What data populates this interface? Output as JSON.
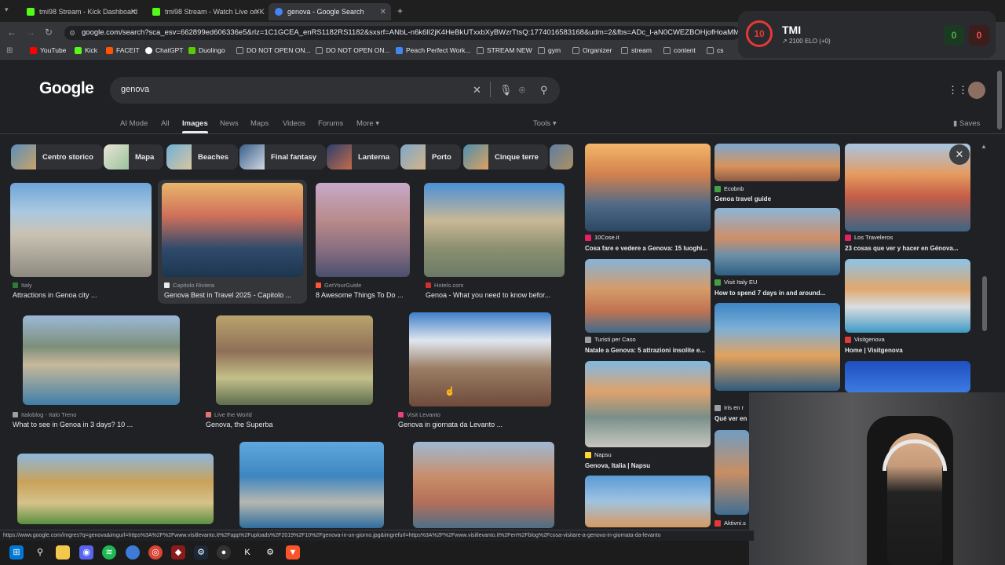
{
  "browser": {
    "tabs": [
      {
        "title": "tmi98 Stream - Kick Dashboard",
        "favicon_color": "#53fc18"
      },
      {
        "title": "tmi98 Stream - Watch Live on K",
        "favicon_color": "#53fc18"
      },
      {
        "title": "genova - Google Search",
        "favicon_color": "#4285f4"
      }
    ],
    "new_tab": "+",
    "url": "google.com/search?sca_esv=662899ed606336e5&rlz=1C1GCEA_enRS1182RS1182&sxsrf=ANbL-n6k6lI2jK4HeBkUTxxbXyBWzrTtsQ:1774016583168&udm=2&fbs=ADc_l-aN0CWEZBOHjofHoaMMDiKpaEV",
    "bookmarks": [
      {
        "label": "YouTube",
        "color": "#ff0000"
      },
      {
        "label": "Kick",
        "color": "#53fc18"
      },
      {
        "label": "FACEIT",
        "color": "#ff5500"
      },
      {
        "label": "ChatGPT",
        "color": "#ffffff"
      },
      {
        "label": "Duolingo",
        "color": "#58cc02"
      },
      {
        "label": "DO NOT OPEN ON...",
        "color": "#9aa0a6"
      },
      {
        "label": "DO NOT OPEN ON...",
        "color": "#9aa0a6"
      },
      {
        "label": "Peach Perfect Work...",
        "color": "#4285f4"
      },
      {
        "label": "STREAM NEW",
        "color": "#9aa0a6"
      },
      {
        "label": "gym",
        "color": "#9aa0a6"
      },
      {
        "label": "Organizer",
        "color": "#9aa0a6"
      },
      {
        "label": "stream",
        "color": "#9aa0a6"
      },
      {
        "label": "content",
        "color": "#9aa0a6"
      },
      {
        "label": "cs",
        "color": "#9aa0a6"
      }
    ]
  },
  "google": {
    "logo": "Google",
    "query": "genova",
    "nav_tabs": [
      "AI Mode",
      "All",
      "Images",
      "News",
      "Maps",
      "Videos",
      "Forums",
      "More"
    ],
    "active_tab": "Images",
    "tools": "Tools",
    "saves": "Saves",
    "chips": [
      "Centro storico",
      "Mapa",
      "Beaches",
      "Final fantasy",
      "Lanterna",
      "Porto",
      "Cinque terre"
    ],
    "results": [
      {
        "source": "Italy",
        "title": "Attractions in Genoa city ..."
      },
      {
        "source": "Capitolo Riviera",
        "title": "Genova Best in Travel 2025 - Capitolo ..."
      },
      {
        "source": "GetYourGuide",
        "title": "8 Awesome Things To Do ..."
      },
      {
        "source": "Hotels.com",
        "title": "Genoa - What you need to know befor..."
      },
      {
        "source": "Italoblog - Italo Treno",
        "title": "What to see in Genoa in 3 days? 10 ..."
      },
      {
        "source": "Live the World",
        "title": "Genova, the Superba"
      },
      {
        "source": "Visit Levanto",
        "title": "Genova in giornata da Levanto ..."
      }
    ],
    "status_url": "https://www.google.com/imgres?q=genova&imgurl=https%3A%2F%2Fwww.visitlevanto.it%2Fapp%2Fuploads%2F2019%2F10%2Fgenova-in-un-giorno.jpg&imgrefurl=https%3A%2F%2Fwww.visitlevanto.it%2Fen%2Fblog%2Fcosa-visitare-a-genova-in-giornata-da-levanto"
  },
  "panel": {
    "items": [
      {
        "source": "10Cose.it",
        "title": "Cosa fare e vedere a Genova: 15 luoghi..."
      },
      {
        "source": "Turisti per Caso",
        "title": "Natale a Genova: 5 attrazioni insolite e..."
      },
      {
        "source": "Napsu",
        "title": "Genova, Italia | Napsu"
      },
      {
        "source": "Ecobnb",
        "title": "Genoa travel guide"
      },
      {
        "source": "Visit Italy EU",
        "title": "How to spend 7 days in and around..."
      },
      {
        "source": "Iris en r",
        "title": "Qué ver en"
      },
      {
        "source": "Aktivni.s",
        "title": ""
      },
      {
        "source": "Los Traveleros",
        "title": "23 cosas que ver y hacer en Génova..."
      },
      {
        "source": "Visitgenova",
        "title": "Home | Visitgenova"
      }
    ]
  },
  "overlay": {
    "level": "10",
    "name": "TMI",
    "elo": "2100 ELO (+0)",
    "wins": "0",
    "losses": "0"
  }
}
